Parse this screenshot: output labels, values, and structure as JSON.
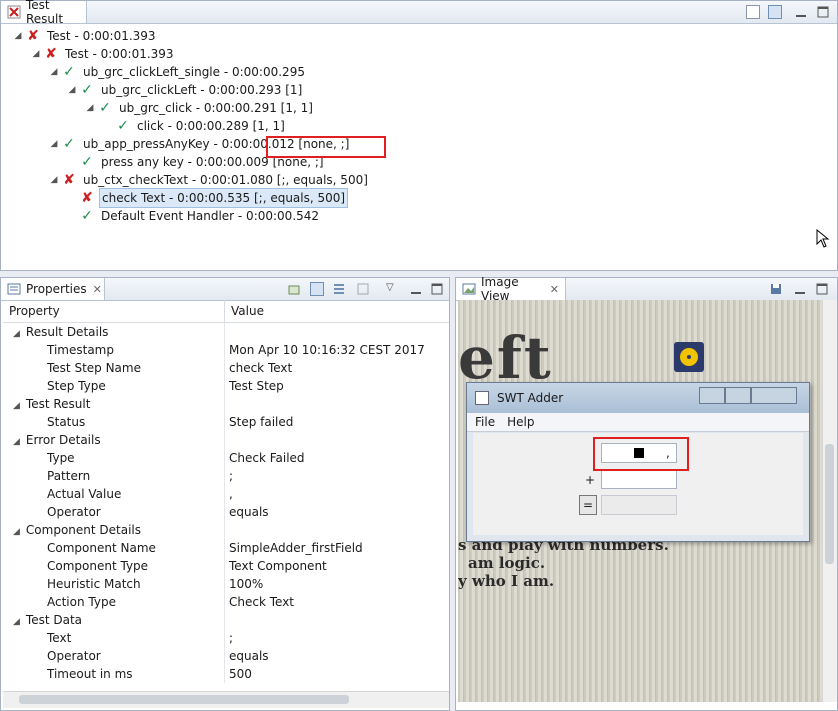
{
  "test_result": {
    "tab_title": "Test Result",
    "tree": [
      {
        "level": 0,
        "status": "fail",
        "label": "Test - 0:00:01.393",
        "expand": "◢"
      },
      {
        "level": 1,
        "status": "fail",
        "label": "Test - 0:00:01.393",
        "expand": "◢"
      },
      {
        "level": 2,
        "status": "ok",
        "label": "ub_grc_clickLeft_single - 0:00:00.295",
        "expand": "◢"
      },
      {
        "level": 3,
        "status": "ok",
        "label": "ub_grc_clickLeft - 0:00:00.293 [1]",
        "expand": "◢"
      },
      {
        "level": 4,
        "status": "ok",
        "label": "ub_grc_click - 0:00:00.291 [1, 1]",
        "expand": "◢"
      },
      {
        "level": 5,
        "status": "ok",
        "label": "click - 0:00:00.289 [1, 1]",
        "expand": ""
      },
      {
        "level": 2,
        "status": "ok",
        "label": "ub_app_pressAnyKey - 0:00:00.012 [none, ;]",
        "expand": "◢"
      },
      {
        "level": 3,
        "status": "ok",
        "label": "press any key - 0:00:00.009 [none, ;]",
        "expand": ""
      },
      {
        "level": 2,
        "status": "fail",
        "label": "ub_ctx_checkText - 0:00:01.080 [;, equals, 500]",
        "expand": "◢"
      },
      {
        "level": 3,
        "status": "fail",
        "label": "check Text - 0:00:00.535 [;, equals, 500]",
        "expand": "",
        "selected": true
      },
      {
        "level": 3,
        "status": "ok",
        "label": "Default Event Handler - 0:00:00.542",
        "expand": ""
      }
    ]
  },
  "properties": {
    "tab_title": "Properties",
    "col_property": "Property",
    "col_value": "Value",
    "rows": [
      {
        "group": true,
        "name": "Result Details",
        "value": ""
      },
      {
        "group": false,
        "name": "Timestamp",
        "value": "Mon Apr 10 10:16:32 CEST 2017"
      },
      {
        "group": false,
        "name": "Test Step Name",
        "value": "check Text"
      },
      {
        "group": false,
        "name": "Step Type",
        "value": "Test Step"
      },
      {
        "group": true,
        "name": "Test Result",
        "value": ""
      },
      {
        "group": false,
        "name": "Status",
        "value": "Step failed"
      },
      {
        "group": true,
        "name": "Error Details",
        "value": ""
      },
      {
        "group": false,
        "name": "Type",
        "value": "Check Failed"
      },
      {
        "group": false,
        "name": "Pattern",
        "value": ";"
      },
      {
        "group": false,
        "name": "Actual Value",
        "value": ","
      },
      {
        "group": false,
        "name": "Operator",
        "value": "equals"
      },
      {
        "group": true,
        "name": "Component Details",
        "value": ""
      },
      {
        "group": false,
        "name": "Component Name",
        "value": "SimpleAdder_firstField"
      },
      {
        "group": false,
        "name": "Component Type",
        "value": "Text Component"
      },
      {
        "group": false,
        "name": "Heuristic Match",
        "value": "100%"
      },
      {
        "group": false,
        "name": "Action Type",
        "value": "Check Text"
      },
      {
        "group": true,
        "name": "Test Data",
        "value": ""
      },
      {
        "group": false,
        "name": "Text",
        "value": ";"
      },
      {
        "group": false,
        "name": "Operator",
        "value": "equals"
      },
      {
        "group": false,
        "name": "Timeout in ms",
        "value": "500"
      }
    ]
  },
  "image_view": {
    "tab_title": "Image View",
    "bg_text_1": "eft",
    "bg_text_2": "s and play with numbers.",
    "bg_text_3": "am logic.",
    "bg_text_4": "y who I am.",
    "swt": {
      "title": "SWT Adder",
      "menu_file": "File",
      "menu_help": "Help",
      "field1_value": ",",
      "plus": "+",
      "equals": "="
    }
  },
  "colors": {
    "fail": "#cc2020",
    "ok": "#1c8a4c",
    "highlight": "#e02020"
  }
}
